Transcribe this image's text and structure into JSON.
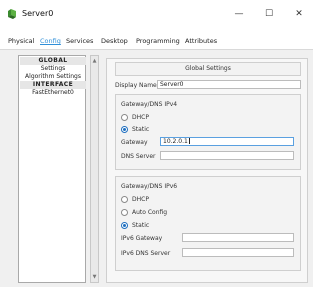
{
  "window": {
    "title": "Server0",
    "minimize_glyph": "—",
    "maximize_glyph": "☐",
    "close_glyph": "✕"
  },
  "tabs": [
    {
      "label": "Physical"
    },
    {
      "label": "Config",
      "active": true
    },
    {
      "label": "Services"
    },
    {
      "label": "Desktop"
    },
    {
      "label": "Programming"
    },
    {
      "label": "Attributes"
    }
  ],
  "sidebar": {
    "items": [
      {
        "label": "GLOBAL",
        "type": "heading"
      },
      {
        "label": "Settings",
        "type": "item"
      },
      {
        "label": "Algorithm Settings",
        "type": "item"
      },
      {
        "label": "INTERFACE",
        "type": "heading"
      },
      {
        "label": "FastEthernet0",
        "type": "item"
      }
    ]
  },
  "settings": {
    "header": "Global Settings",
    "display_name_label": "Display Name",
    "display_name_value": "Server0",
    "ipv4": {
      "title": "Gateway/DNS IPv4",
      "dhcp_label": "DHCP",
      "static_label": "Static",
      "selected": "Static",
      "gateway_label": "Gateway",
      "gateway_value": "10.2.0.1",
      "dns_label": "DNS Server",
      "dns_value": ""
    },
    "ipv6": {
      "title": "Gateway/DNS IPv6",
      "dhcp_label": "DHCP",
      "auto_label": "Auto Config",
      "static_label": "Static",
      "selected": "Static",
      "gateway_label": "IPv6 Gateway",
      "gateway_value": "",
      "dns_label": "IPv6 DNS Server",
      "dns_value": ""
    }
  },
  "colors": {
    "accent": "#2f8fd8",
    "radio_checked": "#1f6fc0"
  }
}
